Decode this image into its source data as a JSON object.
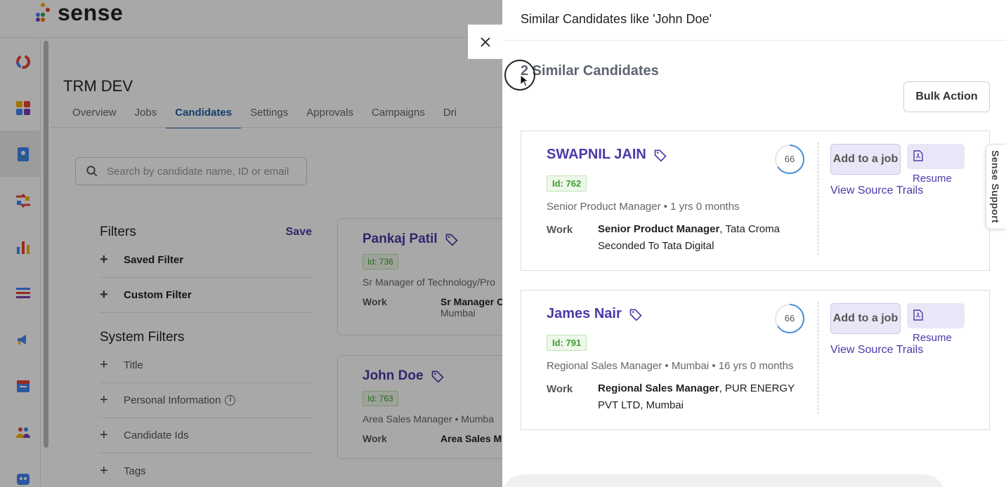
{
  "app": {
    "logo_text": "sense",
    "page_title": "TRM DEV",
    "tabs": [
      "Overview",
      "Jobs",
      "Candidates",
      "Settings",
      "Approvals",
      "Campaigns",
      "Dri"
    ],
    "active_tab": "Candidates",
    "search": {
      "placeholder": "Search by candidate name, ID or email"
    },
    "filters": {
      "title": "Filters",
      "save_label": "Save",
      "groups": [
        "Saved Filter",
        "Custom Filter"
      ],
      "system_title": "System Filters",
      "system_items": [
        "Title",
        "Personal Information",
        "Candidate Ids",
        "Tags"
      ]
    },
    "bg_candidates": [
      {
        "name": "Pankaj Patil",
        "id_label": "Id: 736",
        "role": "Sr Manager of Technology/Pro",
        "work_label": "Work",
        "work_value": "Sr Manager C",
        "work_sub": "Mumbai"
      },
      {
        "name": "John Doe",
        "id_label": "Id: 763",
        "role": "Area Sales Manager • Mumba",
        "work_label": "Work",
        "work_value": "Area Sales M",
        "work_sub": ""
      }
    ]
  },
  "drawer": {
    "title": "Similar Candidates like 'John Doe'",
    "count_title": "2 Similar Candidates",
    "bulk_action_label": "Bulk Action",
    "support_label": "Sense Support",
    "candidates": [
      {
        "name": "SWAPNIL JAIN",
        "id_label": "Id: 762",
        "role": "Senior Product Manager • 1 yrs 0 months",
        "score": "66",
        "score_fraction": 0.66,
        "work_label": "Work",
        "work_title": "Senior Product Manager",
        "work_rest": ", Tata Croma Seconded To Tata Digital",
        "add_job_label": "Add to a job",
        "resume_label": "Resume",
        "trails_label": "View Source Trails"
      },
      {
        "name": "James Nair",
        "id_label": "Id: 791",
        "role": "Regional Sales Manager • Mumbai • 16 yrs 0 months",
        "score": "66",
        "score_fraction": 0.66,
        "work_label": "Work",
        "work_title": "Regional Sales Manager",
        "work_rest": ", PUR ENERGY PVT LTD, Mumbai",
        "add_job_label": "Add to a job",
        "resume_label": "Resume",
        "trails_label": "View Source Trails"
      }
    ]
  },
  "colors": {
    "accent": "#4a3aa8",
    "tab_active": "#1f5fa8",
    "id_green": "#3f9c35",
    "score_ring": "#4a90d9"
  }
}
